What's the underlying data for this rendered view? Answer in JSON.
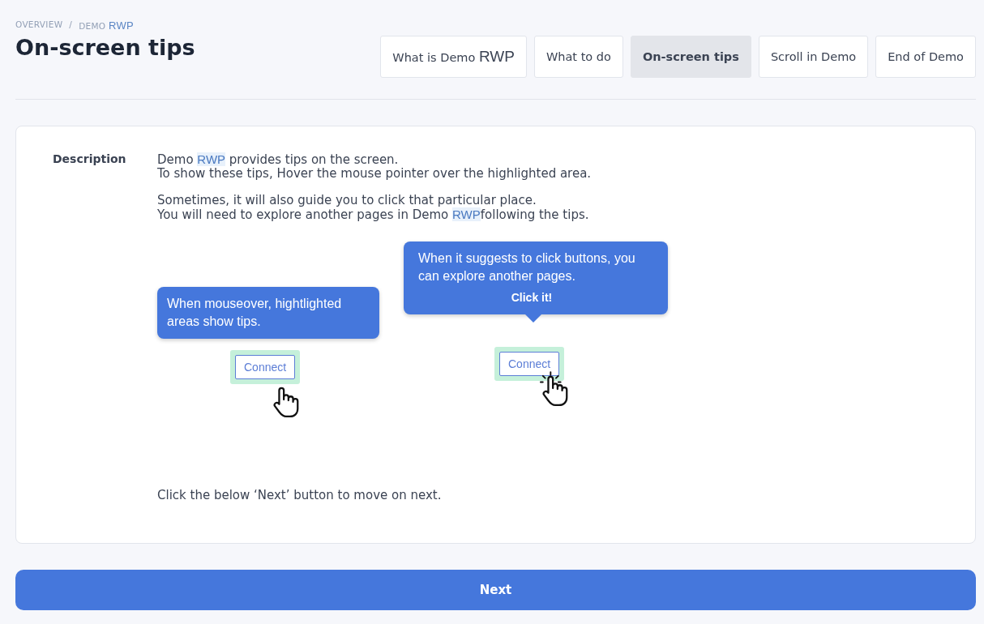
{
  "breadcrumb": [
    {
      "text": "OVERVIEW"
    },
    {
      "text": "/"
    },
    {
      "parts": [
        {
          "text": "DEMO ",
          "kind": "plain"
        },
        {
          "text": "RWP",
          "kind": "highlight"
        }
      ]
    }
  ],
  "title": "On-screen tips",
  "tabs": [
    {
      "parts": [
        {
          "text": "What is Demo ",
          "kind": "plain"
        },
        {
          "text": "RWP",
          "kind": "highlight"
        }
      ],
      "selected": false
    },
    {
      "parts": [
        {
          "text": "What to do",
          "kind": "plain"
        }
      ],
      "selected": false
    },
    {
      "parts": [
        {
          "text": "On-screen tips",
          "kind": "plain"
        }
      ],
      "selected": true
    },
    {
      "parts": [
        {
          "text": "Scroll in Demo",
          "kind": "plain"
        }
      ],
      "selected": false
    },
    {
      "parts": [
        {
          "text": "End of Demo",
          "kind": "plain"
        }
      ],
      "selected": false
    }
  ],
  "description": {
    "label": "Description",
    "paragraphs": [
      [
        [
          {
            "text": "Demo ",
            "kind": "plain"
          },
          {
            "text": "RWP",
            "kind": "highlight"
          },
          {
            "text": " provides tips on the screen.",
            "kind": "plain"
          }
        ],
        [
          {
            "text": "To show these tips, Hover the mouse pointer over the highlighted area.",
            "kind": "plain"
          }
        ]
      ],
      [
        [
          {
            "text": "Sometimes, it will also guide you to click that particular place.",
            "kind": "plain"
          }
        ],
        [
          {
            "text": "You will need to explore another pages in Demo ",
            "kind": "plain"
          },
          {
            "text": "RWP",
            "kind": "highlight"
          },
          {
            "text": "following the tips.",
            "kind": "plain"
          }
        ]
      ]
    ],
    "examples": [
      {
        "tooltip": "When mouseover, hightlighted areas show tips.",
        "pointer": false,
        "button": "Connect",
        "clicking": false
      },
      {
        "tooltip": "When it suggests to click buttons, you can explore another pages.",
        "emphasis": "Click it!",
        "pointer": true,
        "button": "Connect",
        "clicking": true
      }
    ],
    "footer": "Click the below ‘Next’ button to move on next."
  },
  "next_button": "Next"
}
